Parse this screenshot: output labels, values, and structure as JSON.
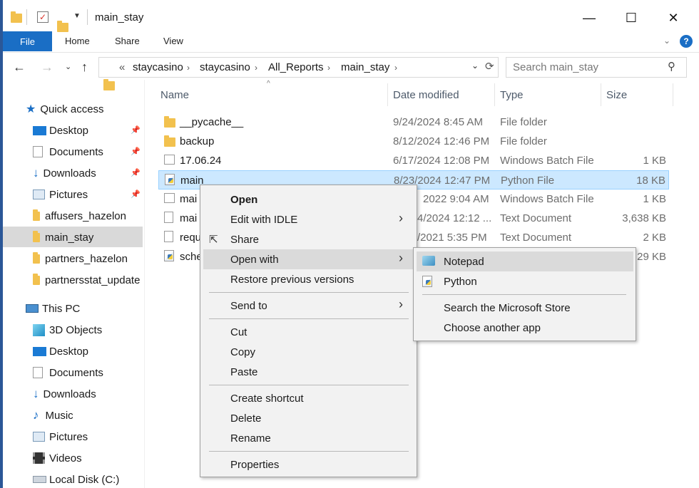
{
  "window": {
    "title": "main_stay",
    "minimize_glyph": "—",
    "maximize_glyph": "☐",
    "close_glyph": "✕"
  },
  "ribbon": {
    "tabs": [
      "File",
      "Home",
      "Share",
      "View"
    ]
  },
  "address": {
    "overflow": "«",
    "crumbs": [
      "staycasino",
      "staycasino",
      "All_Reports",
      "main_stay"
    ],
    "search_placeholder": "Search main_stay"
  },
  "nav": {
    "quick_access": "Quick access",
    "quick_items": [
      "Desktop",
      "Documents",
      "Downloads",
      "Pictures",
      "affusers_hazelon",
      "main_stay",
      "partners_hazelon",
      "partnersstat_update"
    ],
    "this_pc": "This PC",
    "pc_items": [
      "3D Objects",
      "Desktop",
      "Documents",
      "Downloads",
      "Music",
      "Pictures",
      "Videos",
      "Local Disk (C:)"
    ]
  },
  "columns": {
    "name": "Name",
    "date": "Date modified",
    "type": "Type",
    "size": "Size"
  },
  "files": [
    {
      "name": "__pycache__",
      "date": "9/24/2024 8:45 AM",
      "type": "File folder",
      "size": "",
      "icon": "folder-icon"
    },
    {
      "name": "backup",
      "date": "8/12/2024 12:46 PM",
      "type": "File folder",
      "size": "",
      "icon": "folder-icon"
    },
    {
      "name": "17.06.24",
      "date": "6/17/2024 12:08 PM",
      "type": "Windows Batch File",
      "size": "1 KB",
      "icon": "batch-file-icon"
    },
    {
      "name": "main",
      "date": "8/23/2024 12:47 PM",
      "type": "Python File",
      "size": "18 KB",
      "icon": "python-file-icon"
    },
    {
      "name": "mai",
      "date": "2022 9:04 AM",
      "type": "Windows Batch File",
      "size": "1 KB",
      "icon": "batch-file-icon"
    },
    {
      "name": "mai",
      "date": "4/2024 12:12 ...",
      "type": "Text Document",
      "size": "3,638 KB",
      "icon": "text-file-icon"
    },
    {
      "name": "requ",
      "date": "/2021 5:35 PM",
      "type": "Text Document",
      "size": "2 KB",
      "icon": "text-file-icon"
    },
    {
      "name": "sche",
      "date": "",
      "type": "",
      "size": "29 KB",
      "icon": "python-file-icon"
    }
  ],
  "context_menu": {
    "open": "Open",
    "edit_idle": "Edit with IDLE",
    "share": "Share",
    "open_with": "Open with",
    "restore": "Restore previous versions",
    "send_to": "Send to",
    "cut": "Cut",
    "copy": "Copy",
    "paste": "Paste",
    "create_shortcut": "Create shortcut",
    "delete": "Delete",
    "rename": "Rename",
    "properties": "Properties"
  },
  "open_with_menu": {
    "notepad": "Notepad",
    "python": "Python",
    "store": "Search the Microsoft Store",
    "another": "Choose another app"
  },
  "colors": {
    "accent": "#1a6ec5",
    "selection": "#cce8ff",
    "folder": "#f2c14e"
  }
}
